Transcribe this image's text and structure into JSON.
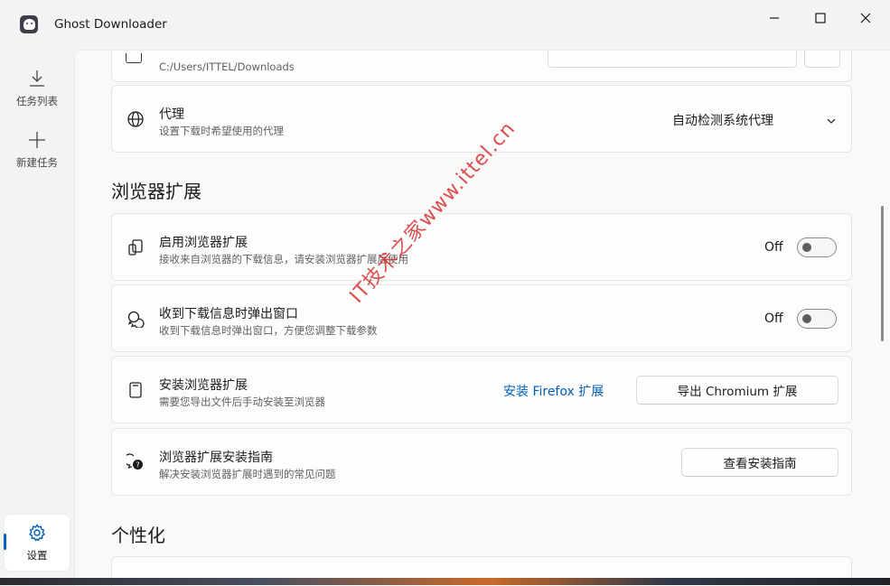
{
  "window": {
    "title": "Ghost Downloader"
  },
  "nav": {
    "task_list": "任务列表",
    "new_task": "新建任务",
    "settings": "设置"
  },
  "download_folder": {
    "path": "C:/Users/ITTEL/Downloads"
  },
  "proxy": {
    "title": "代理",
    "subtitle": "设置下载时希望使用的代理",
    "value": "自动检测系统代理"
  },
  "browser_ext": {
    "section_title": "浏览器扩展",
    "enable": {
      "title": "启用浏览器扩展",
      "subtitle": "接收来自浏览器的下载信息，请安装浏览器扩展后使用",
      "state": "Off",
      "on": false
    },
    "popup": {
      "title": "收到下载信息时弹出窗口",
      "subtitle": "收到下载信息时弹出窗口，方便您调整下载参数",
      "state": "Off",
      "on": false
    },
    "install": {
      "title": "安装浏览器扩展",
      "subtitle": "需要您导出文件后手动安装至浏览器",
      "firefox_link": "安装 Firefox 扩展",
      "export_button": "导出 Chromium 扩展"
    },
    "guide": {
      "title": "浏览器扩展安装指南",
      "subtitle": "解决安装浏览器扩展时遇到的常见问题",
      "button": "查看安装指南"
    }
  },
  "personalization": {
    "section_title": "个性化"
  },
  "watermark": "IT技术之家www.ittel.cn",
  "colors": {
    "accent": "#005fb8",
    "watermark": "#d62828"
  }
}
